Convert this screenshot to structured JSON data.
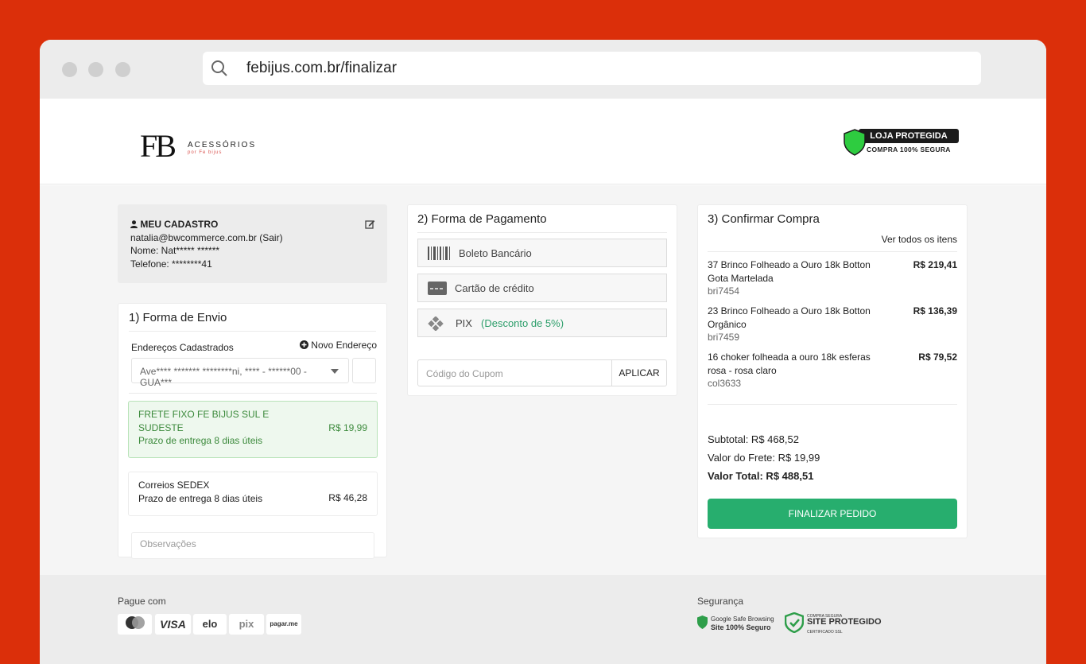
{
  "browser": {
    "url": "febijus.com.br/finalizar"
  },
  "brand": {
    "logo_mark": "FB",
    "logo_text": "ACESSÓRIOS",
    "logo_sub": "por Fe bijus"
  },
  "seal": {
    "title": "LOJA PROTEGIDA",
    "subtitle": "COMPRA 100% SEGURA"
  },
  "account": {
    "title": "MEU CADASTRO",
    "email": "natalia@bwcommerce.com.br (Sair)",
    "name": "Nome: Nat***** ******",
    "phone": "Telefone: ********41"
  },
  "shipping": {
    "title": "1) Forma de Envio",
    "addresses_label": "Endereços Cadastrados",
    "new_address": "Novo Endereço",
    "selected_address": "Ave**** ******* ********ni, **** - ******00 - GUA***",
    "options": [
      {
        "name": "FRETE FIXO FE BIJUS SUL E SUDESTE",
        "deadline": "Prazo de entrega 8 dias úteis",
        "price": "R$ 19,99"
      },
      {
        "name": "Correios SEDEX",
        "deadline": "Prazo de entrega 8 dias úteis",
        "price": "R$ 46,28"
      }
    ],
    "notes_placeholder": "Observações"
  },
  "payment": {
    "title": "2) Forma de Pagamento",
    "methods": [
      {
        "label": "Boleto Bancário"
      },
      {
        "label": "Cartão de crédito"
      },
      {
        "label": "PIX",
        "note": "(Desconto de 5%)"
      }
    ],
    "coupon_placeholder": "Código do Cupom",
    "coupon_button": "APLICAR"
  },
  "confirm": {
    "title": "3) Confirmar Compra",
    "view_all": "Ver todos os itens",
    "items": [
      {
        "name": "37 Brinco Folheado a Ouro 18k Botton Gota Martelada",
        "sku": "bri7454",
        "price": "R$ 219,41"
      },
      {
        "name": "23 Brinco Folheado a Ouro 18k Botton Orgânico",
        "sku": "bri7459",
        "price": "R$ 136,39"
      },
      {
        "name": "16 choker folheada a ouro 18k esferas rosa - rosa claro",
        "sku": "col3633",
        "price": "R$ 79,52"
      }
    ],
    "subtotal": "Subtotal: R$ 468,52",
    "freight": "Valor do Frete: R$ 19,99",
    "total": "Valor Total: R$ 488,51",
    "finish_button": "FINALIZAR PEDIDO"
  },
  "footer": {
    "pay_with": "Pague com",
    "cards": [
      "VISA",
      "elo",
      "pix",
      "pagar.me"
    ],
    "security": "Segurança",
    "google_line1": "Google Safe Browsing",
    "google_line2": "Site 100% Seguro",
    "site_line1": "COMPRA SEGURA",
    "site_line2": "SITE PROTEGIDO",
    "site_line3": "CERTIFICADO SSL"
  },
  "colors": {
    "background": "#db2f0a",
    "accent": "#27ae6e",
    "selected_shipping": "#eef8ee",
    "seal_shield": "#2ecc40"
  },
  "icons": [
    "search-icon",
    "shield-icon",
    "user-icon",
    "edit-icon",
    "plus-circle-icon",
    "barcode-icon",
    "credit-card-icon",
    "pix-icon",
    "mastercard-icon"
  ]
}
